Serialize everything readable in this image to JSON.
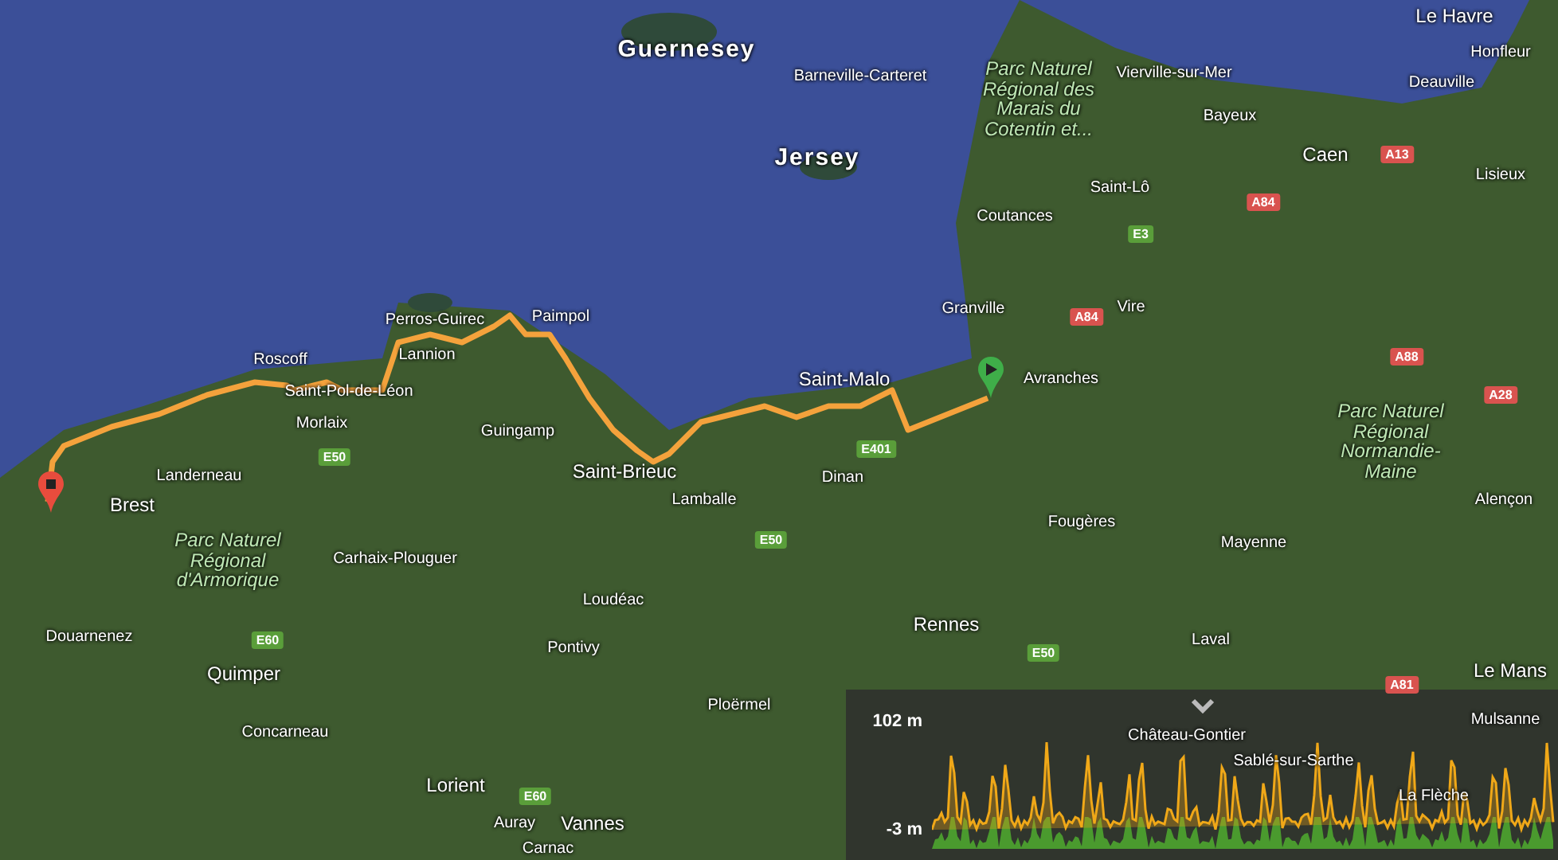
{
  "map": {
    "labels": [
      {
        "text": "Guernesey",
        "kind": "island"
      },
      {
        "text": "Barneville-Carteret",
        "kind": "town"
      },
      {
        "text": "Jersey",
        "kind": "island"
      },
      {
        "text": "Parc Naturel Régional des Marais du Cotentin et...",
        "kind": "park"
      },
      {
        "text": "Vierville-sur-Mer",
        "kind": "town"
      },
      {
        "text": "Le Havre",
        "kind": "city"
      },
      {
        "text": "Honfleur",
        "kind": "town"
      },
      {
        "text": "Deauville",
        "kind": "town"
      },
      {
        "text": "Bayeux",
        "kind": "town"
      },
      {
        "text": "Caen",
        "kind": "city"
      },
      {
        "text": "Lisieux",
        "kind": "town"
      },
      {
        "text": "Saint-Lô",
        "kind": "town"
      },
      {
        "text": "Coutances",
        "kind": "town"
      },
      {
        "text": "Vire",
        "kind": "town"
      },
      {
        "text": "Granville",
        "kind": "town"
      },
      {
        "text": "Avranches",
        "kind": "town"
      },
      {
        "text": "Roscoff",
        "kind": "town"
      },
      {
        "text": "Perros-Guirec",
        "kind": "town"
      },
      {
        "text": "Lannion",
        "kind": "town"
      },
      {
        "text": "Paimpol",
        "kind": "town"
      },
      {
        "text": "Saint-Pol-de-Léon",
        "kind": "town"
      },
      {
        "text": "Morlaix",
        "kind": "town"
      },
      {
        "text": "Guingamp",
        "kind": "town"
      },
      {
        "text": "Saint-Brieuc",
        "kind": "city"
      },
      {
        "text": "Saint-Malo",
        "kind": "city"
      },
      {
        "text": "Landerneau",
        "kind": "town"
      },
      {
        "text": "Brest",
        "kind": "city"
      },
      {
        "text": "Parc Naturel Régional d'Armorique",
        "kind": "park"
      },
      {
        "text": "Carhaix-Plouguer",
        "kind": "town"
      },
      {
        "text": "Lamballe",
        "kind": "town"
      },
      {
        "text": "Dinan",
        "kind": "town"
      },
      {
        "text": "Fougères",
        "kind": "town"
      },
      {
        "text": "Mayenne",
        "kind": "town"
      },
      {
        "text": "Parc Naturel Régional Normandie-Maine",
        "kind": "park"
      },
      {
        "text": "Alençon",
        "kind": "town"
      },
      {
        "text": "Loudéac",
        "kind": "town"
      },
      {
        "text": "Rennes",
        "kind": "city"
      },
      {
        "text": "Laval",
        "kind": "town"
      },
      {
        "text": "Le Mans",
        "kind": "city"
      },
      {
        "text": "Douarnenez",
        "kind": "town"
      },
      {
        "text": "Quimper",
        "kind": "city"
      },
      {
        "text": "Pontivy",
        "kind": "town"
      },
      {
        "text": "Ploërmel",
        "kind": "town"
      },
      {
        "text": "Concarneau",
        "kind": "town"
      },
      {
        "text": "Lorient",
        "kind": "city"
      },
      {
        "text": "Auray",
        "kind": "town"
      },
      {
        "text": "Vannes",
        "kind": "city"
      },
      {
        "text": "Carnac",
        "kind": "town"
      },
      {
        "text": "Château-Gontier",
        "kind": "town"
      },
      {
        "text": "Sablé-sur-Sarthe",
        "kind": "town"
      },
      {
        "text": "La Flèche",
        "kind": "town"
      },
      {
        "text": "Mulsanne",
        "kind": "town"
      }
    ],
    "roads": [
      {
        "text": "E50",
        "color": "#5a9e3a"
      },
      {
        "text": "E401",
        "color": "#5a9e3a"
      },
      {
        "text": "E50",
        "color": "#5a9e3a"
      },
      {
        "text": "E50",
        "color": "#5a9e3a"
      },
      {
        "text": "E60",
        "color": "#5a9e3a"
      },
      {
        "text": "E60",
        "color": "#5a9e3a"
      },
      {
        "text": "A84",
        "color": "#d9534f"
      },
      {
        "text": "A84",
        "color": "#d9534f"
      },
      {
        "text": "A13",
        "color": "#d9534f"
      },
      {
        "text": "E3",
        "color": "#5a9e3a"
      },
      {
        "text": "A88",
        "color": "#d9534f"
      },
      {
        "text": "A28",
        "color": "#d9534f"
      },
      {
        "text": "A81",
        "color": "#d9534f"
      }
    ],
    "markers": [
      {
        "kind": "end",
        "color": "#e84c3d"
      },
      {
        "kind": "start",
        "color": "#3fae49"
      }
    ]
  },
  "elevation": {
    "max_label": "102 m",
    "min_label": "-3 m"
  }
}
